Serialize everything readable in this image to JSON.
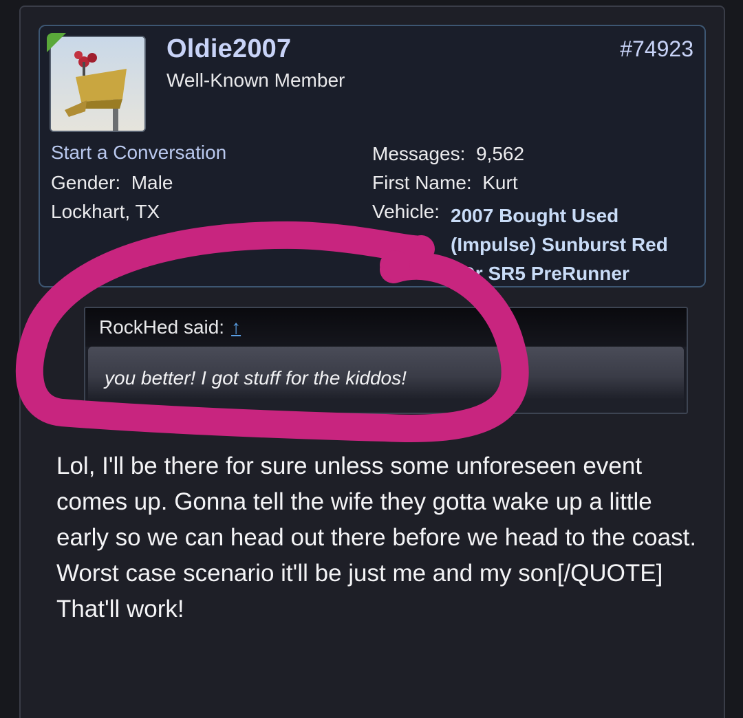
{
  "post": {
    "username": "Oldie2007",
    "user_title": "Well-Known Member",
    "post_number": "#74923",
    "start_conversation": "Start a Conversation",
    "gender_label": "Gender:",
    "gender_value": "Male",
    "location": "Lockhart, TX",
    "messages_label": "Messages:",
    "messages_value": "9,562",
    "first_name_label": "First Name:",
    "first_name_value": "Kurt",
    "vehicle_label": "Vehicle:",
    "vehicle_value": "2007 Bought Used (Impulse) Sunburst Red 4Dr SR5 PreRunner",
    "online_color": "#5aa83a"
  },
  "quote": {
    "attribution": "RockHed said:",
    "jump_icon": "up-arrow-icon",
    "jump_glyph": "↑",
    "text": "you better! I got stuff for the kiddos!"
  },
  "message": {
    "body": "Lol, I'll be there for sure unless some unforeseen event comes up. Gonna tell the wife they gotta wake up a little early so we can head out there before we head to the coast. Worst case scenario it'll be just me and my son[/QUOTE]\nThat'll work!"
  },
  "colors": {
    "annotation": "#c8257f",
    "username": "#c8d3f7",
    "link": "#5aa0e6",
    "card_border": "#3d5672"
  }
}
